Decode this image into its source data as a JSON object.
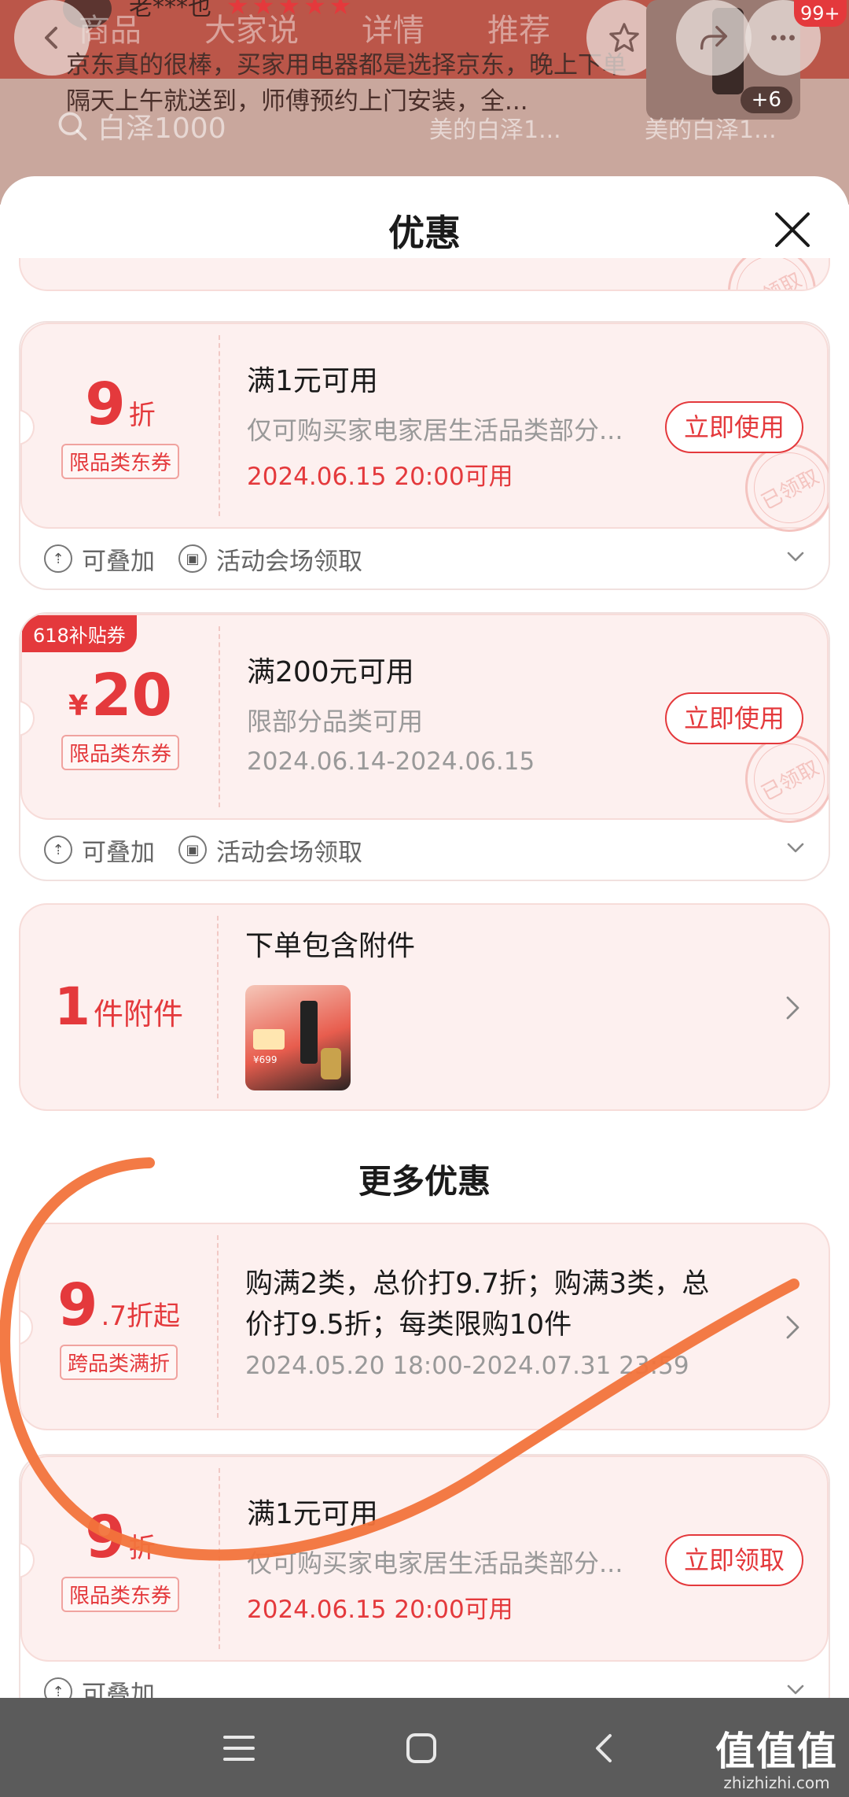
{
  "background": {
    "user_name": "老***也",
    "stars": "★★★★★",
    "tabs": [
      "商品",
      "大家说",
      "详情",
      "推荐"
    ],
    "review_text": "京东真的很棒，买家用电器都是选择京东，晚上下单隔天上午就送到，师傅预约上门安装，全...",
    "thumb_more": "+6",
    "notification_badge": "99+",
    "search_text": "白泽1000",
    "chips": [
      "美的白泽1...",
      "美的白泽1..."
    ]
  },
  "sheet": {
    "title": "优惠",
    "close_label": "×"
  },
  "coupons": [
    {
      "amount": "9",
      "unit": "折",
      "tag": "限品类东券",
      "condition": "满1元可用",
      "scope": "仅可购买家电家居生活品类部分...",
      "time": "2024.06.15 20:00可用",
      "button": "立即使用",
      "stamp": "已领取",
      "foot_stack": "可叠加",
      "foot_source": "活动会场领取"
    },
    {
      "ribbon": "618补贴券",
      "currency": "¥",
      "amount": "20",
      "tag": "限品类东券",
      "condition": "满200元可用",
      "scope": "限部分品类可用",
      "time": "2024.06.14-2024.06.15",
      "button": "立即使用",
      "stamp": "已领取",
      "foot_stack": "可叠加",
      "foot_source": "活动会场领取"
    }
  ],
  "gift": {
    "amount": "1",
    "unit": "件附件",
    "title": "下单包含附件",
    "thumb_text": "¥699"
  },
  "more_title": "更多优惠",
  "more": [
    {
      "amount": "9",
      "unit": ".7折起",
      "tag": "跨品类满折",
      "condition": "购满2类，总价打9.7折；购满3类，总价打9.5折；每类限购10件",
      "time": "2024.05.20 18:00-2024.07.31 23:59"
    },
    {
      "amount": "9",
      "unit": "折",
      "tag": "限品类东券",
      "condition": "满1元可用",
      "scope": "仅可购买家电家居生活品类部分...",
      "time": "2024.06.15 20:00可用",
      "button": "立即领取",
      "foot_stack": "可叠加"
    }
  ],
  "watermark": {
    "main": "值值值",
    "sub": "zhizhizhi.com"
  },
  "colors": {
    "accent": "#e4393c",
    "annotation": "#f2733b",
    "card_bg": "#fdf0ef"
  }
}
